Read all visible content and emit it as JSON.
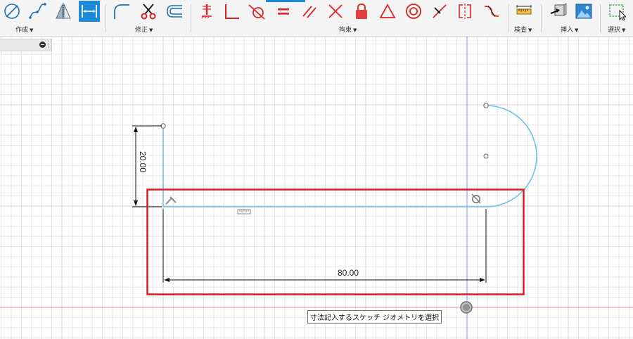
{
  "toolbar": {
    "groups": {
      "create": "作成",
      "modify": "修正",
      "constraints": "拘束",
      "inspect": "検査",
      "insert": "挿入",
      "select": "選択"
    },
    "caret": "▼"
  },
  "colors": {
    "toolbar_bg": "#f4f4f4",
    "accent": "#1d8ad9",
    "constraint_red": "#e0332f",
    "sketch_line": "#6ec3e2",
    "selection_box": "#e0101a",
    "grid": "#e6e6e6",
    "grid_major": "#d2d2d2"
  },
  "sketch": {
    "vertical_dimension": "20.00",
    "horizontal_dimension": "80.00"
  },
  "status": {
    "prompt": "寸法記入するスケッチ ジオメトリを選択"
  }
}
